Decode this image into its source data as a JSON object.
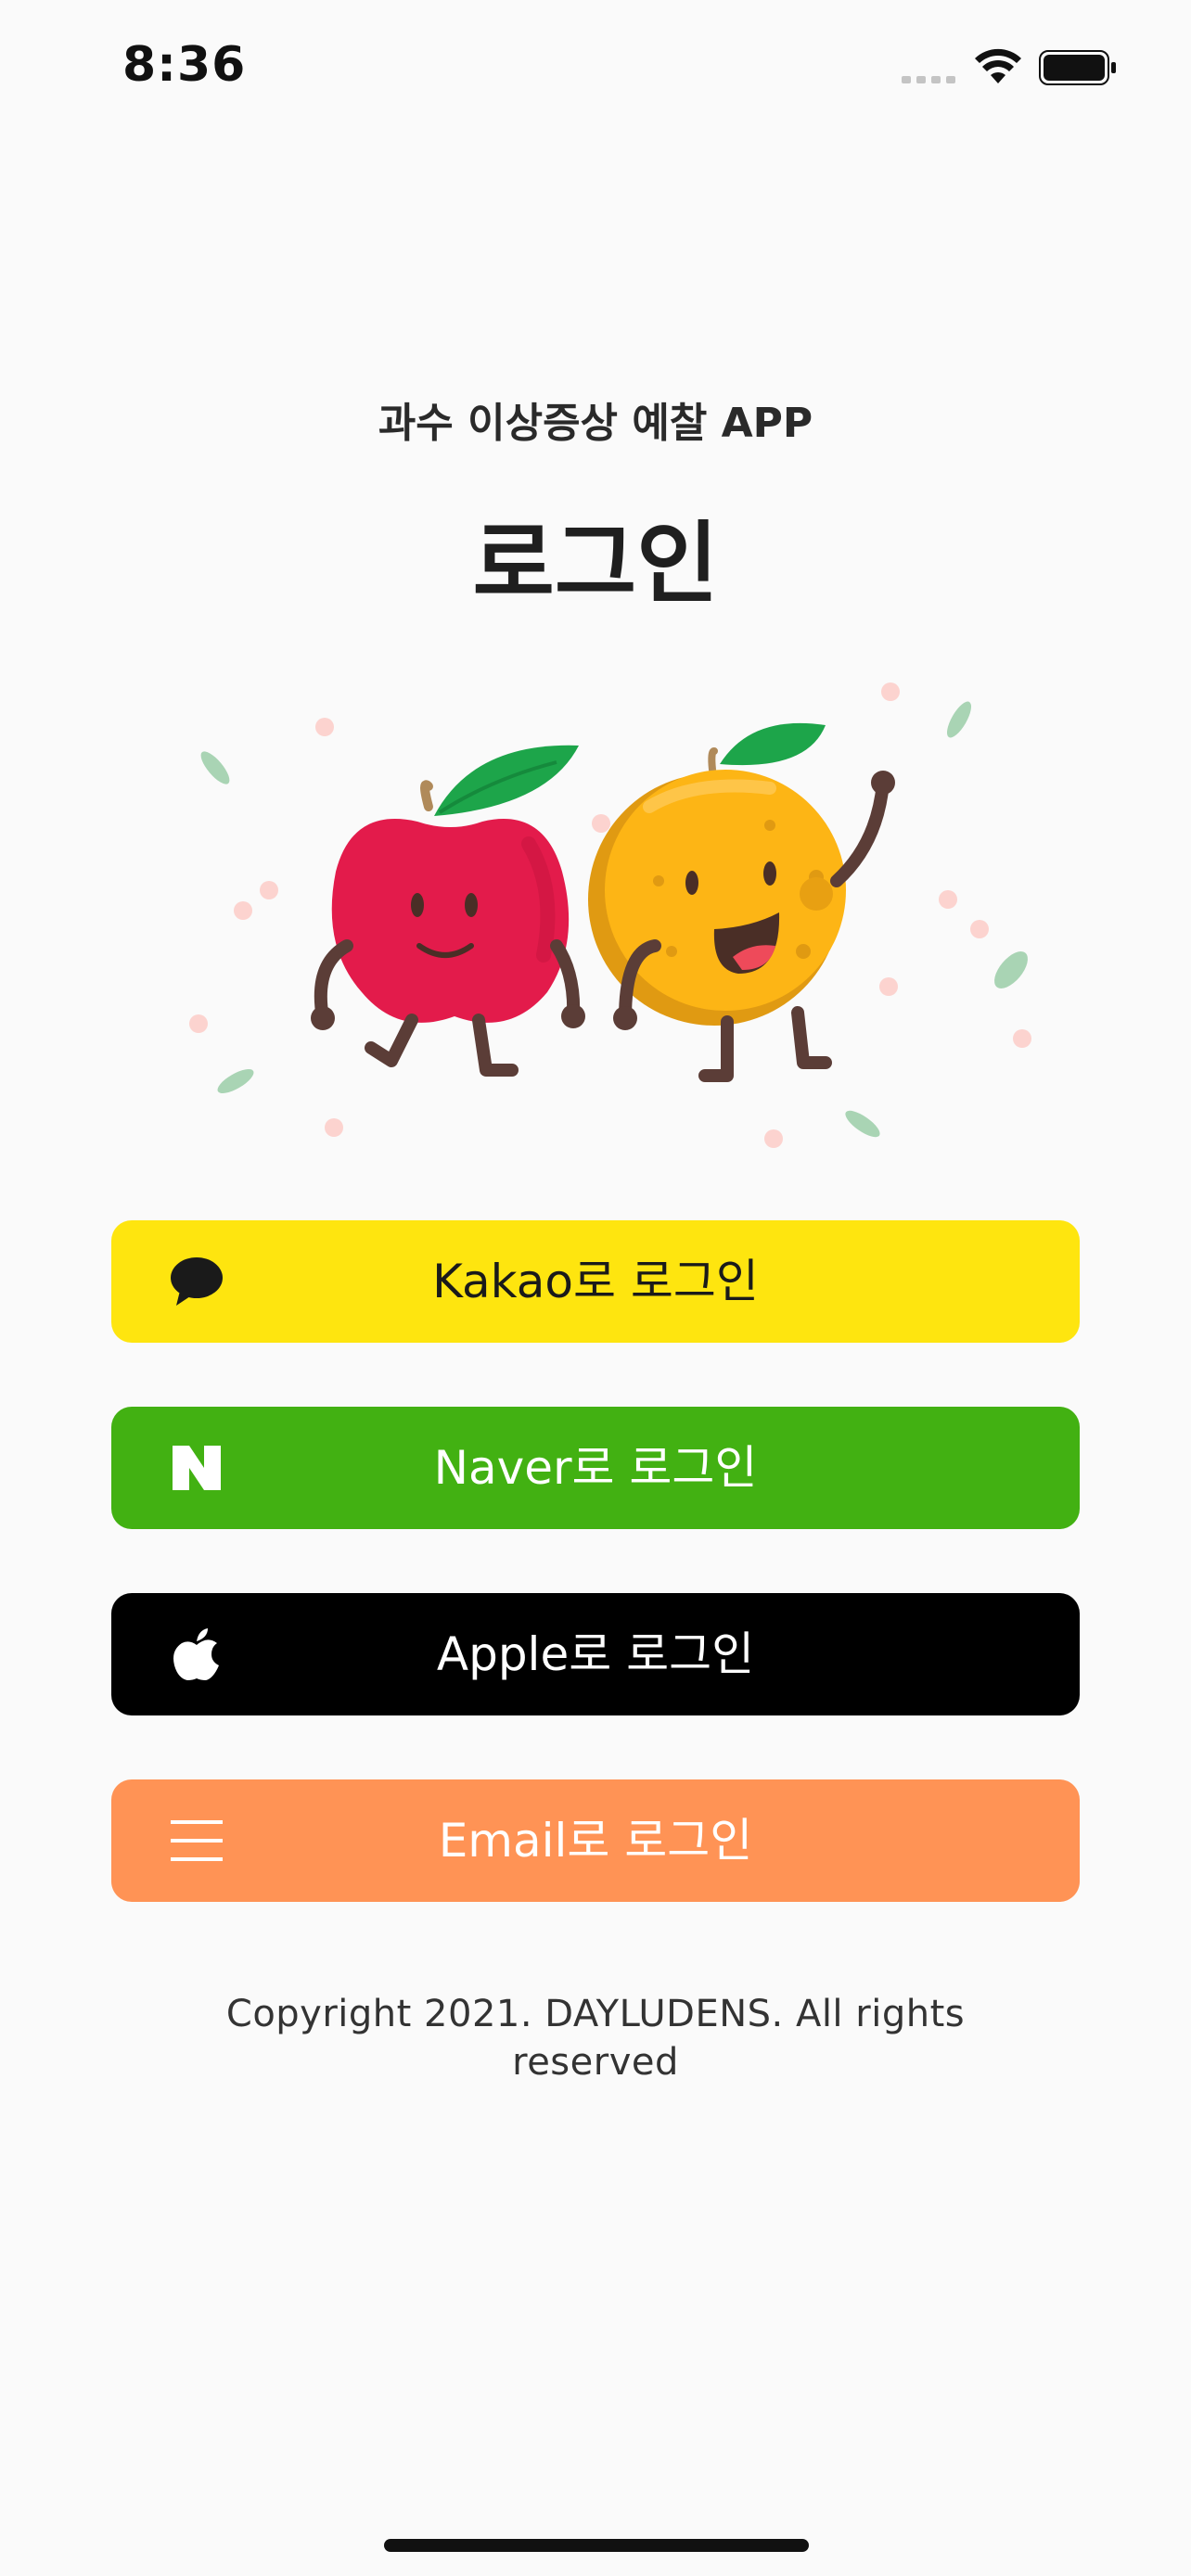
{
  "status_bar": {
    "time": "8:36",
    "icons": [
      "cellular-signal-icon",
      "wifi-icon",
      "battery-icon"
    ]
  },
  "header": {
    "subtitle": "과수 이상증상 예찰 APP",
    "title": "로그인"
  },
  "illustration": {
    "description_icon": "apple-and-orange-mascots-illustration"
  },
  "buttons": [
    {
      "id": "kakao",
      "label": "Kakao로 로그인",
      "icon": "kakao-speech-bubble-icon",
      "color": "#fee50f"
    },
    {
      "id": "naver",
      "label": "Naver로 로그인",
      "icon": "naver-n-icon",
      "color": "#42b112"
    },
    {
      "id": "apple",
      "label": "Apple로 로그인",
      "icon": "apple-logo-icon",
      "color": "#000000"
    },
    {
      "id": "email",
      "label": "Email로 로그인",
      "icon": "hamburger-menu-icon",
      "color": "#ff9355"
    }
  ],
  "footer": {
    "copyright": "Copyright 2021. DAYLUDENS. All rights reserved"
  }
}
